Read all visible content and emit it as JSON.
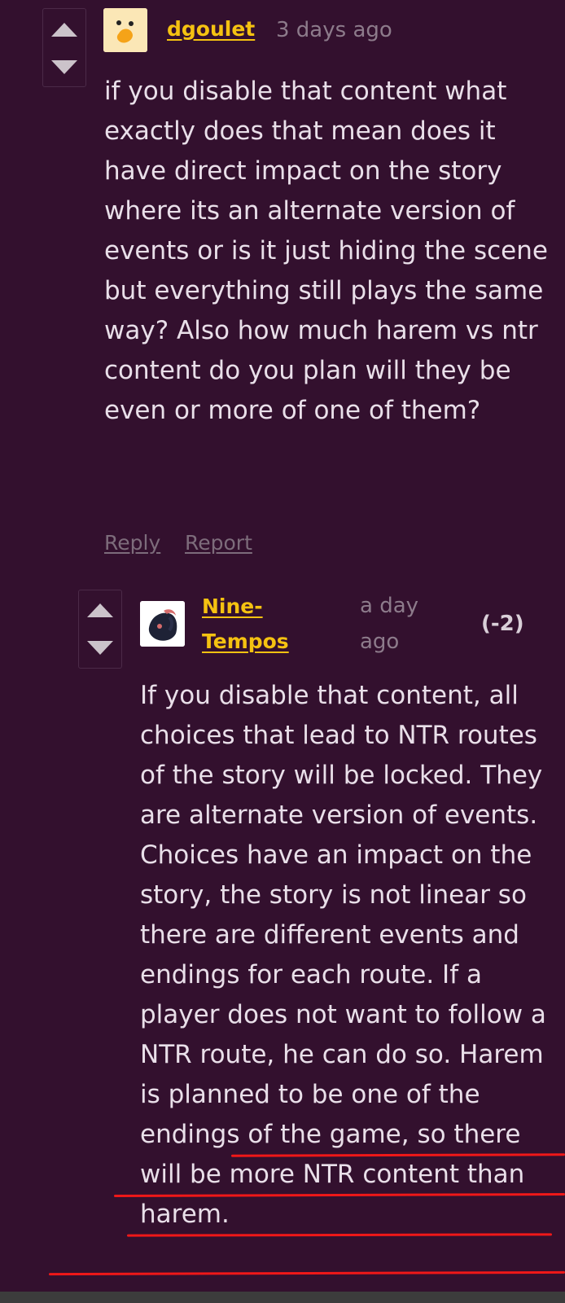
{
  "comments": [
    {
      "username": "dgoulet",
      "timestamp": "3 days ago",
      "body": "if you disable that content what exactly does that mean does it have direct impact on the story where its an alternate version of events or is it just hiding the scene but everything still plays the same way? Also how much harem vs ntr content do you plan will they be even or more of one of them?",
      "actions": {
        "reply": "Reply",
        "report": "Report"
      }
    },
    {
      "username": "Nine-Tempos",
      "username_line1": "Nine-",
      "username_line2": "Tempos",
      "timestamp_line1": "a day",
      "timestamp_line2": "ago",
      "score": "(-2)",
      "body": "If you disable that content, all choices that lead to NTR routes of the story will be locked. They are alternate version of events. Choices have an impact on the story, the story is not linear so there are different events and endings for each route. If a player does not want to follow a NTR route, he can do so. Harem is planned to be one of the endings of the game, so there will be more NTR content than harem."
    }
  ],
  "icons": {
    "upvote": "upvote-arrow-icon",
    "downvote": "downvote-arrow-icon"
  },
  "colors": {
    "background": "#33102e",
    "username": "#f5c211",
    "text": "#e9dfe9",
    "muted": "#8d7b8b",
    "annotation": "#f01818"
  }
}
